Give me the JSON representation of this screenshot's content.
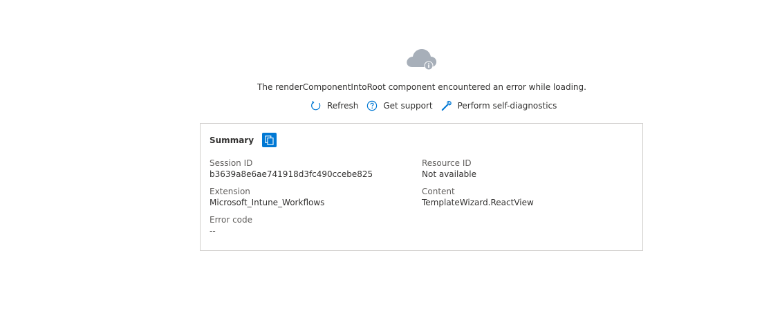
{
  "icons": {
    "status": "cloud-info-icon",
    "refresh": "refresh-icon",
    "support": "help-circle-icon",
    "diagnostics": "wrench-icon",
    "copy": "copy-icon"
  },
  "colors": {
    "accent": "#0078d4",
    "icon_blue": "#0078d4",
    "cloud_gray": "#a7afb9",
    "text": "#323130",
    "label": "#605e5c",
    "border": "#d2d0ce"
  },
  "error": {
    "message": "The renderComponentIntoRoot component encountered an error while loading."
  },
  "actions": {
    "refresh_label": "Refresh",
    "support_label": "Get support",
    "diagnostics_label": "Perform self-diagnostics"
  },
  "summary": {
    "title": "Summary",
    "fields": {
      "session_id": {
        "label": "Session ID",
        "value": "b3639a8e6ae741918d3fc490ccebe825"
      },
      "resource_id": {
        "label": "Resource ID",
        "value": "Not available"
      },
      "extension": {
        "label": "Extension",
        "value": "Microsoft_Intune_Workflows"
      },
      "content": {
        "label": "Content",
        "value": "TemplateWizard.ReactView"
      },
      "error_code": {
        "label": "Error code",
        "value": "--"
      }
    }
  }
}
